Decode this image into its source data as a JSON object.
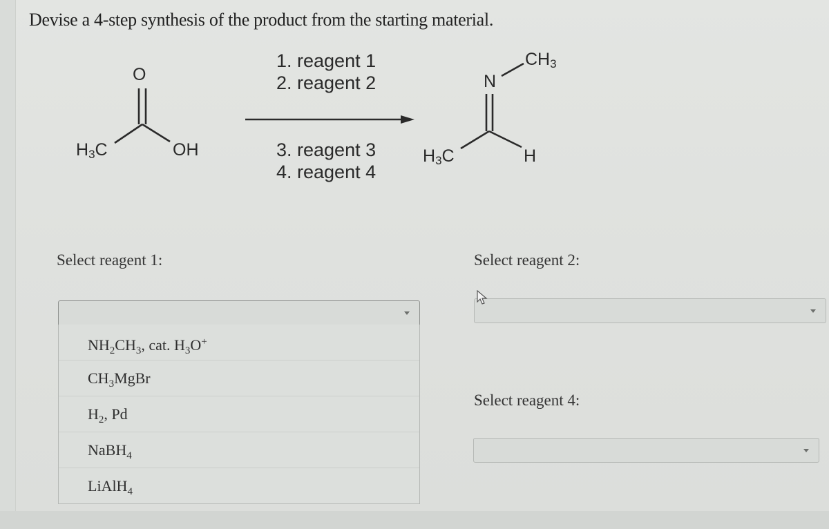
{
  "question": "Devise a 4-step synthesis of the product from the starting material.",
  "scheme": {
    "starting_material": {
      "name": "acetic acid",
      "labels": {
        "oxygen": "O",
        "methyl": "H3C",
        "hydroxyl": "OH"
      }
    },
    "product": {
      "name": "N-methylethanimine",
      "labels": {
        "n_methyl": "CH3",
        "nitrogen": "N",
        "methyl": "H3C",
        "hydrogen": "H"
      }
    },
    "steps_above": [
      "1. reagent 1",
      "2. reagent 2"
    ],
    "steps_below": [
      "3. reagent 3",
      "4. reagent 4"
    ]
  },
  "selectors": [
    {
      "label": "Select reagent 1:",
      "value": "",
      "open": true,
      "options": [
        {
          "parts": [
            [
              "t",
              "NH"
            ],
            [
              "sub",
              "2"
            ],
            [
              "t",
              "CH"
            ],
            [
              "sub",
              "3"
            ],
            [
              "t",
              ", cat. H"
            ],
            [
              "sub",
              "3"
            ],
            [
              "t",
              "O"
            ],
            [
              "sup",
              "+"
            ]
          ],
          "text": "NH2CH3, cat. H3O+"
        },
        {
          "parts": [
            [
              "t",
              "CH"
            ],
            [
              "sub",
              "3"
            ],
            [
              "t",
              "MgBr"
            ]
          ],
          "text": "CH3MgBr"
        },
        {
          "parts": [
            [
              "t",
              "H"
            ],
            [
              "sub",
              "2"
            ],
            [
              "t",
              ", Pd"
            ]
          ],
          "text": "H2, Pd"
        },
        {
          "parts": [
            [
              "t",
              "NaBH"
            ],
            [
              "sub",
              "4"
            ]
          ],
          "text": "NaBH4"
        },
        {
          "parts": [
            [
              "t",
              "LiAlH"
            ],
            [
              "sub",
              "4"
            ]
          ],
          "text": "LiAlH4"
        }
      ]
    },
    {
      "label": "Select reagent 2:",
      "value": "",
      "open": false
    },
    {
      "label": "Select reagent 4:",
      "value": "",
      "open": false
    }
  ],
  "colors": {
    "background": "#dfe1de",
    "text": "#2b2b2b",
    "select_fill": "#d8dbd8",
    "select_border": "#b5b8b5"
  }
}
